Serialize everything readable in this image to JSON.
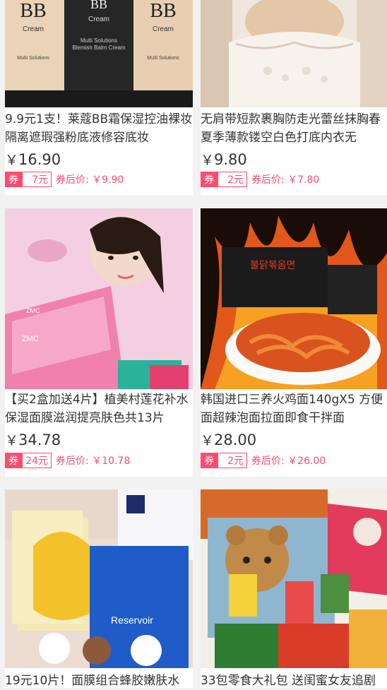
{
  "products": [
    {
      "title": "9.9元1支！莱蔻BB霜保湿控油裸妆隔离遮瑕强粉底液修容底妆",
      "price": "16.90",
      "coupon_tag": "券",
      "coupon_amount": "7元",
      "after_price": "券后价: ￥9.90",
      "image_labels": [
        "BB",
        "Cream",
        "Multi Solutions",
        "Blemish Balm Cream"
      ]
    },
    {
      "title": "无肩带短款裹胸防走光蕾丝抹胸春夏季薄款镂空白色打底内衣无",
      "price": "9.80",
      "coupon_tag": "券",
      "coupon_amount": "2元",
      "after_price": "券后价: ￥7.80"
    },
    {
      "title": "【买2盒加送4片】植美村莲花补水保湿面膜滋润提亮肤色共13片",
      "price": "34.78",
      "coupon_tag": "券",
      "coupon_amount": "24元",
      "after_price": "券后价: ￥10.78",
      "image_labels": [
        "ZMC",
        "ZMC"
      ]
    },
    {
      "title": "韩国进口三养火鸡面140gX5 方便面超辣泡面拉面即食干拌面",
      "price": "28.00",
      "coupon_tag": "券",
      "coupon_amount": "2元",
      "after_price": "券后价: ￥26.00"
    },
    {
      "title": "19元10片！面膜组合蜂胶嫩肤水",
      "price": "",
      "coupon_tag": "",
      "coupon_amount": "",
      "after_price": "",
      "image_labels": [
        "Reservoir"
      ]
    },
    {
      "title": "33包零食大礼包 送闺蜜女友追剧",
      "price": "",
      "coupon_tag": "",
      "coupon_amount": "",
      "after_price": ""
    }
  ],
  "currency": "￥",
  "colors": {
    "accent": "#ff4b6e",
    "background": "#f2f2f2"
  }
}
